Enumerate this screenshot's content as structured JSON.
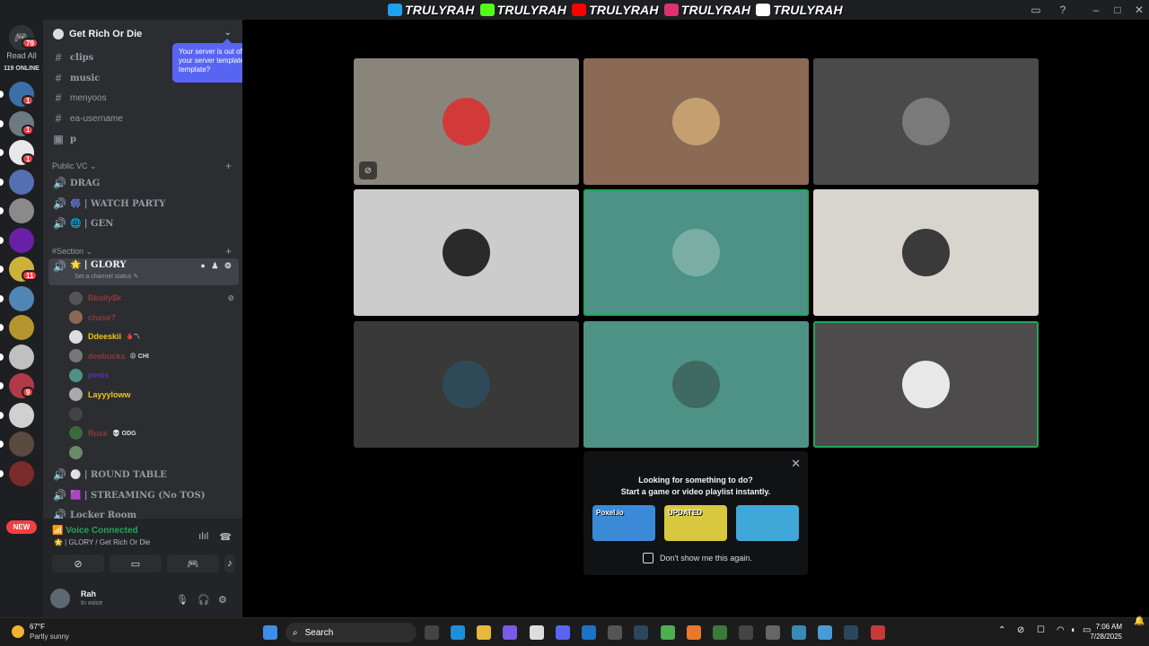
{
  "titlebar": {
    "brands": [
      {
        "name": "TRULYRAH",
        "icon": "twitter-icon",
        "color": "#1da1f2"
      },
      {
        "name": "TRULYRAH",
        "icon": "kick-icon",
        "color": "#53fc18"
      },
      {
        "name": "TRULYRAH",
        "icon": "youtube-icon",
        "color": "#ff0000"
      },
      {
        "name": "TRULYRAH",
        "icon": "instagram-icon",
        "color": "#e1306c"
      },
      {
        "name": "TRULYRAH",
        "icon": "tiktok-icon",
        "color": "#ffffff"
      }
    ]
  },
  "rail": {
    "home_badge": "79",
    "read_all": "Read All",
    "online": "119 ONLINE",
    "servers": [
      {
        "color": "#3b6fa8",
        "badge": "1"
      },
      {
        "color": "#6d7a84",
        "badge": "1"
      },
      {
        "color": "#e8e8e8",
        "badge": "1"
      },
      {
        "color": "#5570b0",
        "badge": ""
      },
      {
        "color": "#8a8a8a",
        "badge": ""
      },
      {
        "color": "#6a1fa8",
        "badge": ""
      },
      {
        "color": "#cbb33a",
        "badge": "11"
      },
      {
        "color": "#4f86b5",
        "badge": ""
      },
      {
        "color": "#b5952e",
        "badge": ""
      },
      {
        "color": "#c0c0c0",
        "badge": ""
      },
      {
        "color": "#b03a48",
        "badge": "9"
      },
      {
        "color": "#d0d0d0",
        "badge": ""
      },
      {
        "color": "#5a4a40",
        "badge": ""
      },
      {
        "color": "#7a2a2a",
        "badge": ""
      }
    ],
    "new_label": "NEW"
  },
  "sidebar": {
    "server_name": "Get Rich Or Die",
    "text_channels": [
      "clips",
      "music",
      "menyoos",
      "ea-username",
      "p"
    ],
    "category_public": "Public VC",
    "public_channels": [
      "DRAG",
      "🎆 | WATCH PARTY",
      "🌐 | GEN"
    ],
    "category_section": "#Section",
    "active_channel": "🌟 | GLORY",
    "active_status": "Set a channel status ✎",
    "members": [
      {
        "name": "Bkully$k",
        "color": "#8a3a3a",
        "tag": "",
        "muted": true
      },
      {
        "name": "chase?",
        "color": "#8a3a3a",
        "tag": "",
        "muted": false
      },
      {
        "name": "Ddeeskii",
        "color": "#f0c419",
        "tag": "🩸〽",
        "muted": false
      },
      {
        "name": "deebucks",
        "color": "#8a3a3a",
        "tag": "😡 CHI",
        "muted": false
      },
      {
        "name": "penis",
        "color": "#5b2fa8",
        "tag": "",
        "muted": false
      },
      {
        "name": "Layyyloww",
        "color": "#f0c419",
        "tag": "",
        "muted": false
      },
      {
        "name": "",
        "color": "#8a3a3a",
        "tag": "",
        "muted": false
      },
      {
        "name": "Ruse",
        "color": "#8a3a3a",
        "tag": "💀 ODG",
        "muted": false
      },
      {
        "name": "",
        "color": "#8a3a3a",
        "tag": "",
        "muted": false
      }
    ],
    "lower_channels": [
      "⚪ | ROUND TABLE",
      "🟪 | STREAMING (No TOS)",
      "Locker Room"
    ]
  },
  "tooltip": {
    "text": "Your server is out of sync with your server template. Sync template?"
  },
  "voice": {
    "title": "Voice Connected",
    "location": "🌟 | GLORY / Get Rich Or Die",
    "user_name": "Rah",
    "user_status": "In voice"
  },
  "tiles": [
    {
      "bg": "#8a857a",
      "avatar": "#d23a3a",
      "speaking": false,
      "muted": true
    },
    {
      "bg": "#8a6a55",
      "avatar": "#c4a070",
      "speaking": false,
      "muted": false
    },
    {
      "bg": "#4a4a4a",
      "avatar": "#7a7a7a",
      "speaking": false,
      "muted": false
    },
    {
      "bg": "#cccccc",
      "avatar": "#2a2a2a",
      "speaking": false,
      "muted": false
    },
    {
      "bg": "#4e9285",
      "avatar": "#7aaea4",
      "speaking": true,
      "muted": false
    },
    {
      "bg": "#d8d5cf",
      "avatar": "#3a3a3a",
      "speaking": false,
      "muted": false
    },
    {
      "bg": "#3a3939",
      "avatar": "#2e4a58",
      "speaking": false,
      "muted": false
    },
    {
      "bg": "#4e9285",
      "avatar": "#3e6a62",
      "speaking": false,
      "muted": false
    },
    {
      "bg": "#4e4b4c",
      "avatar": "#e8e8e8",
      "speaking": true,
      "muted": false
    }
  ],
  "activity": {
    "line1": "Looking for something to do?",
    "line2": "Start a game or video playlist instantly.",
    "games": [
      {
        "label": "Poxel.io",
        "color": "#3a8ad8"
      },
      {
        "label": "UPDATED",
        "color": "#d8c840"
      },
      {
        "label": "",
        "color": "#40a8d8"
      }
    ],
    "checkbox_label": "Don't show me this again."
  },
  "taskbar": {
    "temp": "67°F",
    "condition": "Partly sunny",
    "search": "Search",
    "time": "7:06 AM",
    "date": "7/28/2025"
  }
}
